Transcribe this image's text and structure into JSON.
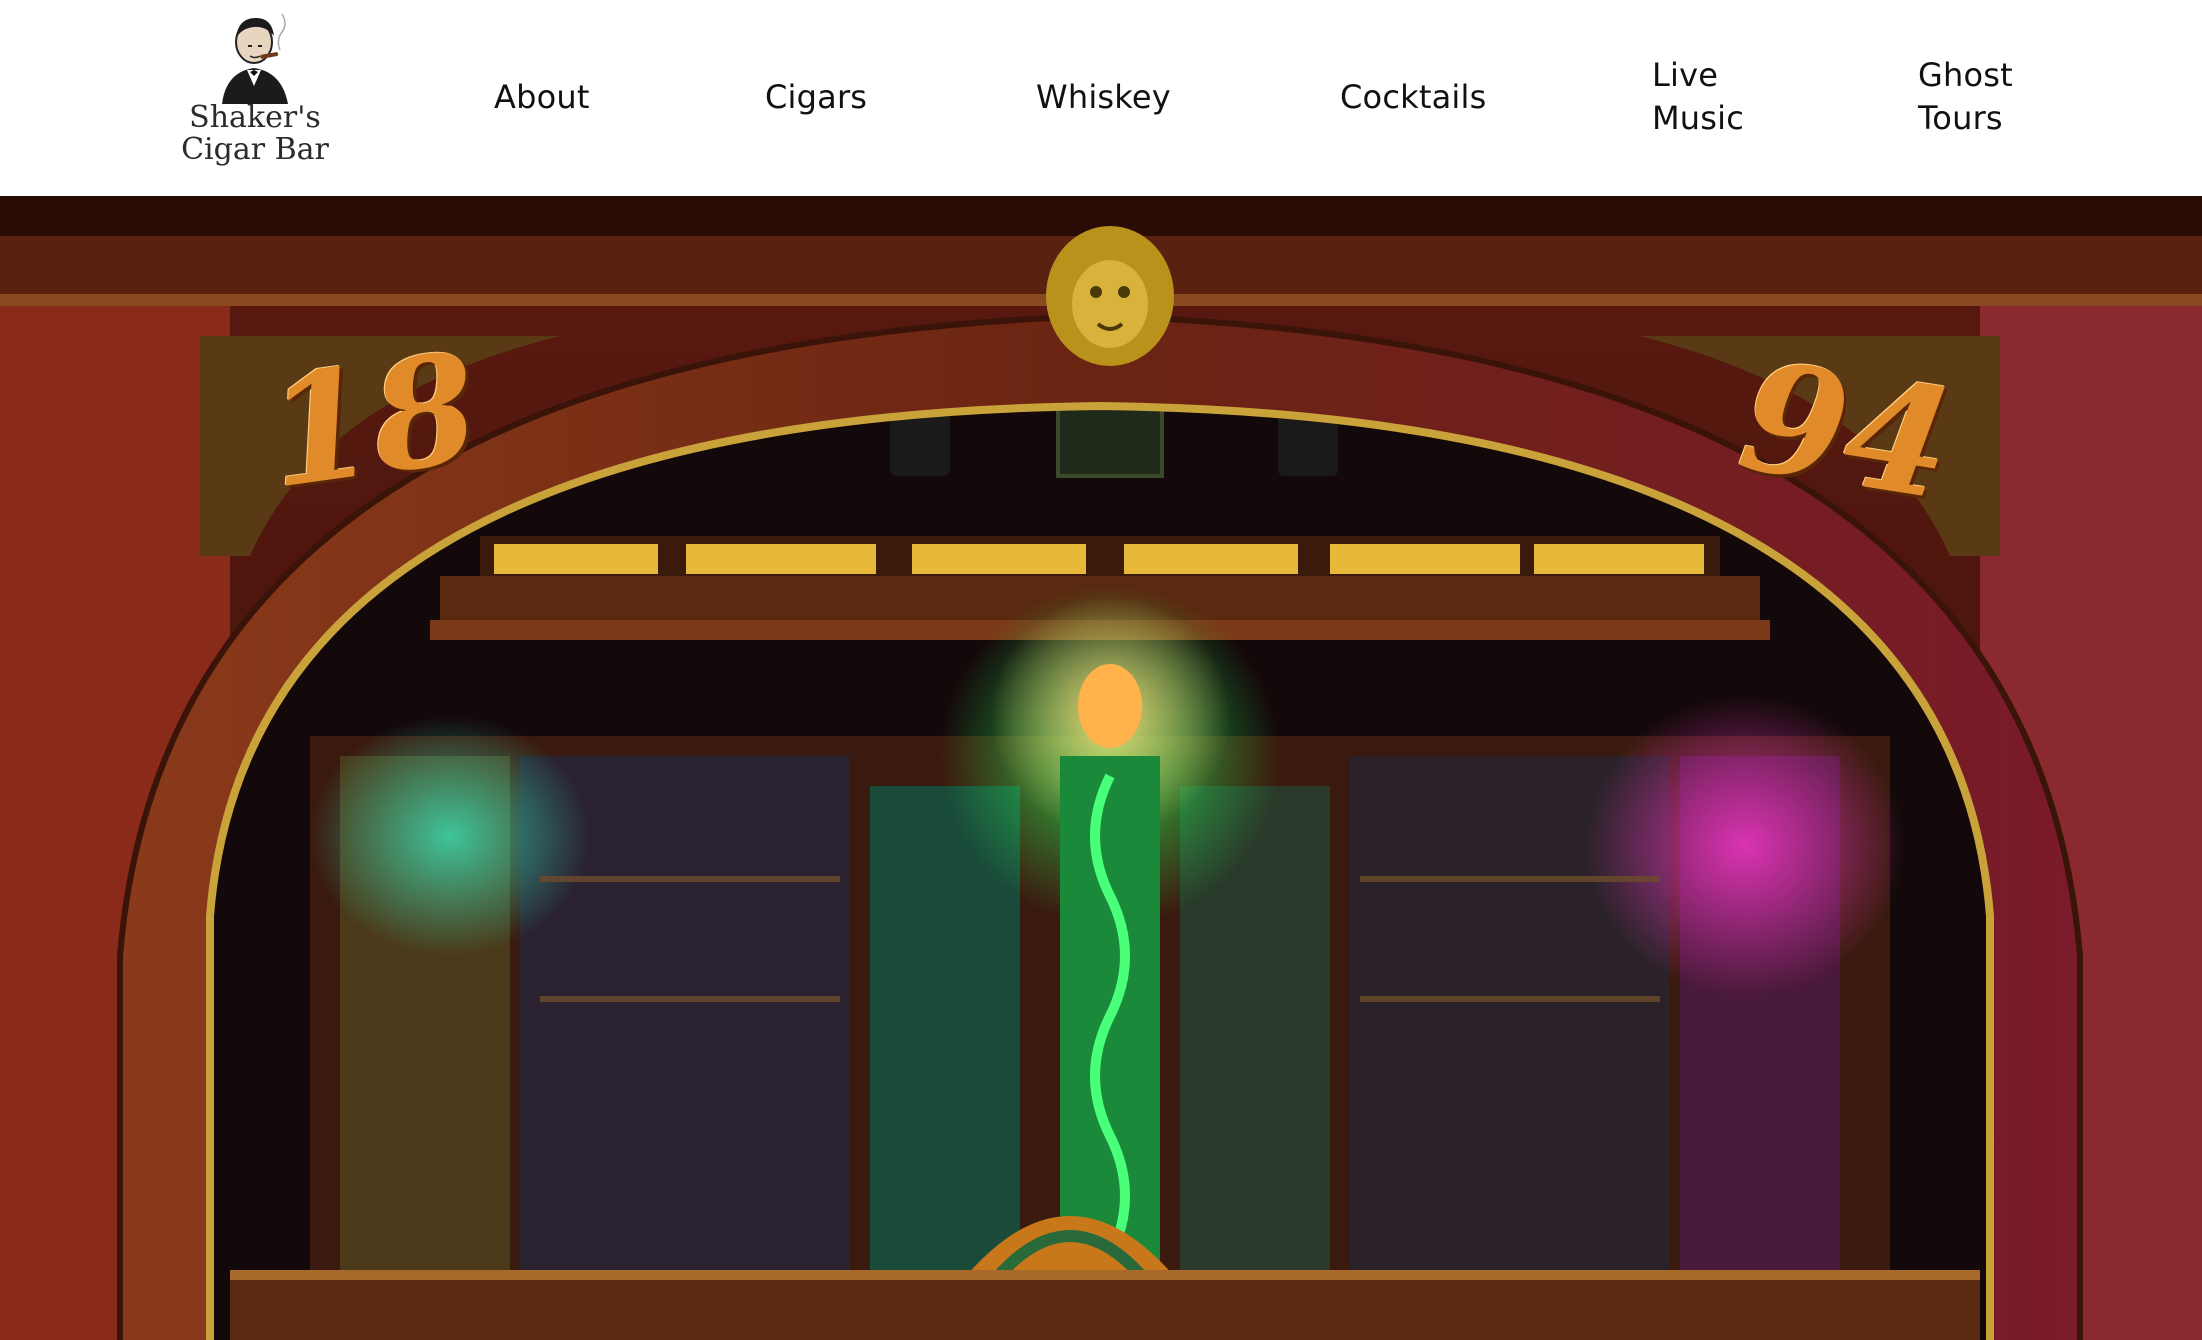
{
  "brand": {
    "logo_text_line1": "Shaker's",
    "logo_text_line2": "Cigar Bar",
    "logo_icon": "gentleman-smoking-portrait-icon"
  },
  "nav": {
    "about": "About",
    "cigars": "Cigars",
    "whiskey": "Whiskey",
    "cocktails": "Cocktails",
    "live_music_line1": "Live",
    "live_music_line2": "Music",
    "ghost_tours_line1": "Ghost",
    "ghost_tours_line2": "Tours"
  },
  "hero": {
    "arch_numeral_left": "18",
    "arch_numeral_right": "94"
  },
  "colors": {
    "header_bg": "#ffffff",
    "nav_text": "#111111",
    "wood_dark": "#3a1408",
    "wood_red": "#7a2418",
    "gold": "#c9a23a",
    "numeral": "#e08a2a"
  }
}
